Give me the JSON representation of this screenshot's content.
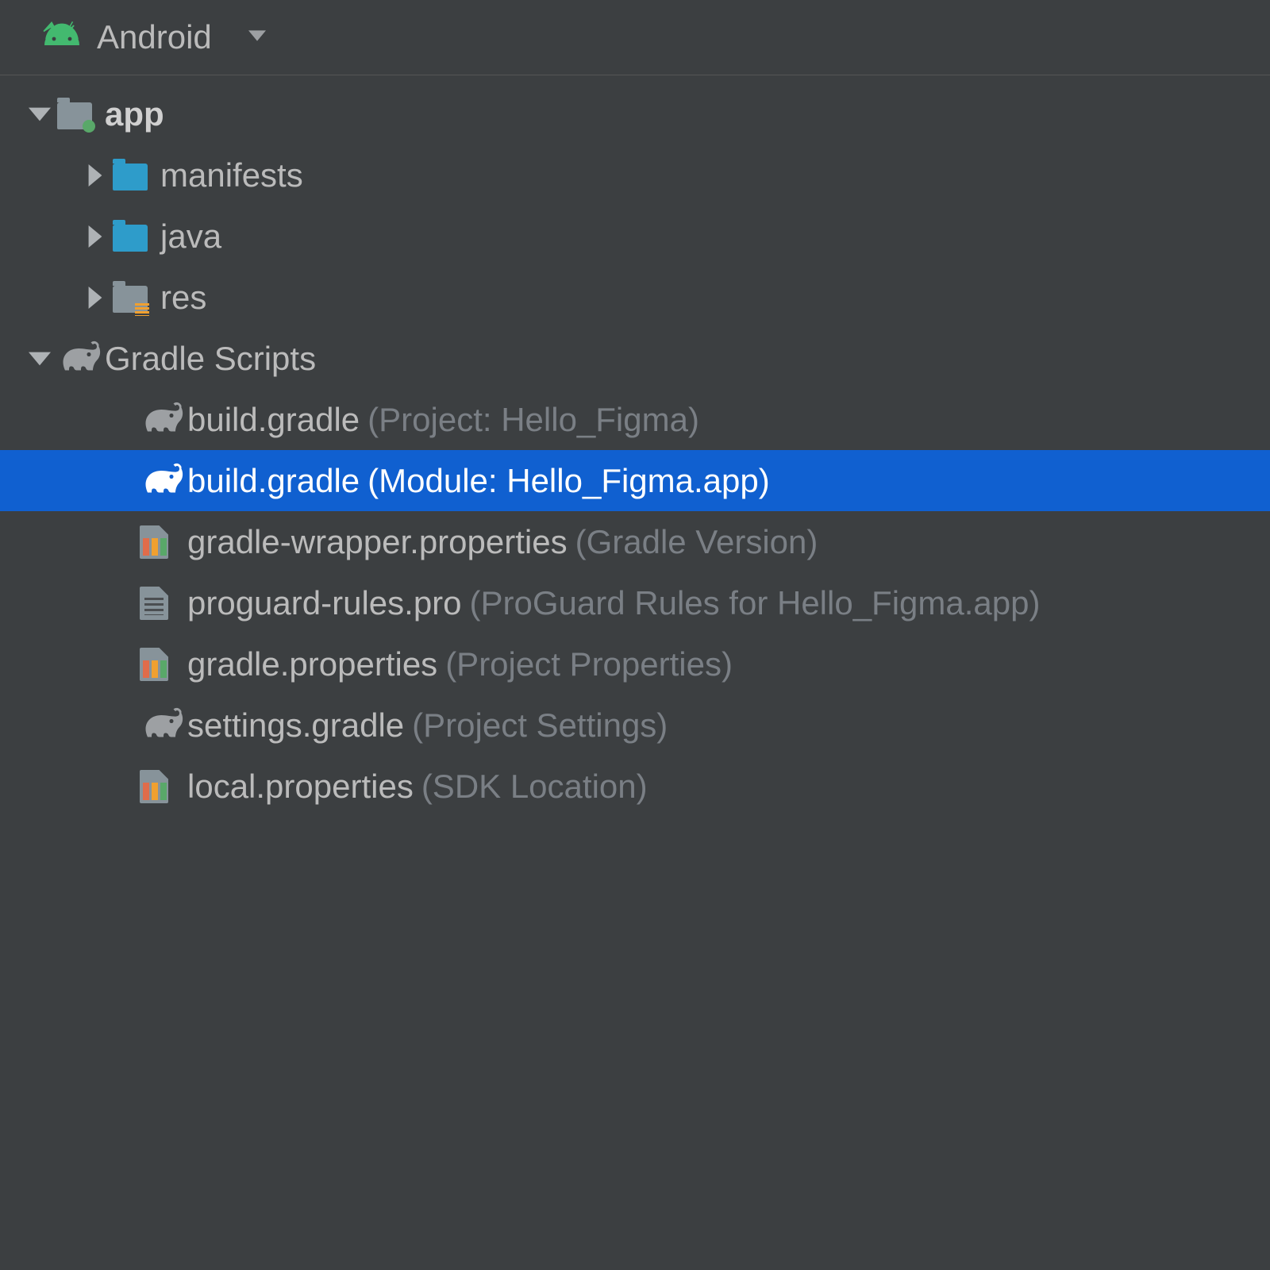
{
  "header": {
    "view_label": "Android"
  },
  "tree": {
    "app": {
      "label": "app",
      "children": {
        "manifests": "manifests",
        "java": "java",
        "res": "res"
      }
    },
    "gradle_scripts": {
      "label": "Gradle Scripts",
      "items": [
        {
          "name": "build.gradle",
          "hint": "(Project: Hello_Figma)",
          "icon": "gradle",
          "selected": false
        },
        {
          "name": "build.gradle",
          "hint": "(Module: Hello_Figma.app)",
          "icon": "gradle",
          "selected": true
        },
        {
          "name": "gradle-wrapper.properties",
          "hint": "(Gradle Version)",
          "icon": "properties",
          "selected": false
        },
        {
          "name": "proguard-rules.pro",
          "hint": "(ProGuard Rules for Hello_Figma.app)",
          "icon": "textdoc",
          "selected": false
        },
        {
          "name": "gradle.properties",
          "hint": "(Project Properties)",
          "icon": "properties",
          "selected": false
        },
        {
          "name": "settings.gradle",
          "hint": "(Project Settings)",
          "icon": "gradle",
          "selected": false
        },
        {
          "name": "local.properties",
          "hint": "(SDK Location)",
          "icon": "properties",
          "selected": false
        }
      ]
    }
  }
}
